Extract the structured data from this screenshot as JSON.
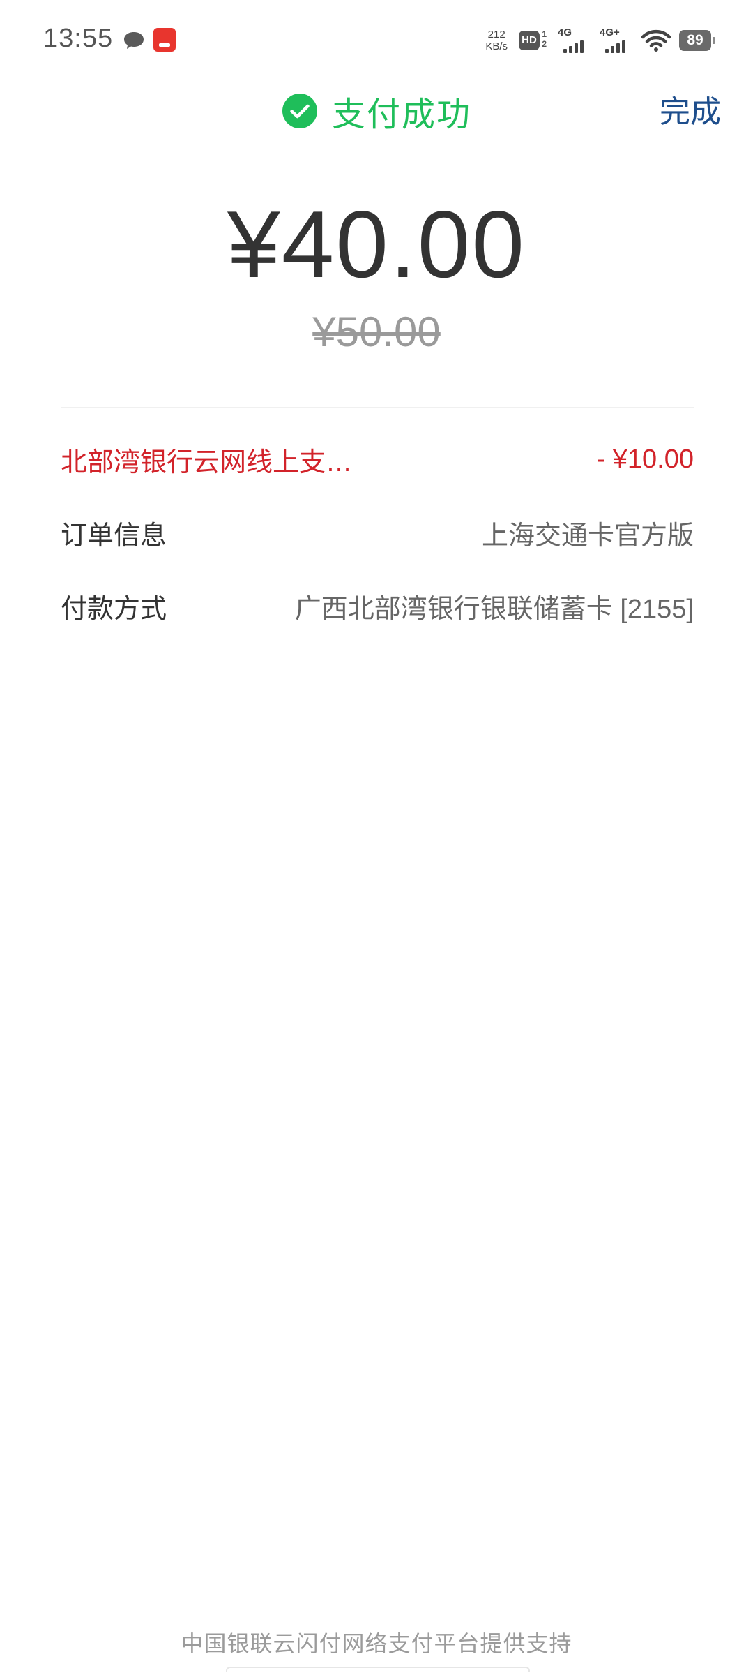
{
  "status_bar": {
    "time": "13:55",
    "net_speed_value": "212",
    "net_speed_unit": "KB/s",
    "hd_label": "HD",
    "hd_sub_top": "1",
    "hd_sub_bottom": "2",
    "signal_1_label": "4G",
    "signal_2_label": "4G+",
    "battery_level": "89",
    "icons": [
      "chat-bubble-icon",
      "app-notification-icon",
      "hd-voice-icon",
      "signal-icon",
      "wifi-icon",
      "battery-icon"
    ]
  },
  "header": {
    "title": "支付成功",
    "done_label": "完成",
    "accent_color": "#1fbe5a",
    "done_color": "#1e4e8c"
  },
  "payment": {
    "amount": "¥40.00",
    "original_amount": "¥50.00"
  },
  "details": {
    "discount_label": "北部湾银行云网线上支…",
    "discount_value": "- ¥10.00",
    "discount_color": "#d2232a",
    "order_label": "订单信息",
    "order_value": "上海交通卡官方版",
    "payment_method_label": "付款方式",
    "payment_method_value": "广西北部湾银行银联储蓄卡 [2155]"
  },
  "footer": {
    "text": "中国银联云闪付网络支付平台提供支持"
  }
}
